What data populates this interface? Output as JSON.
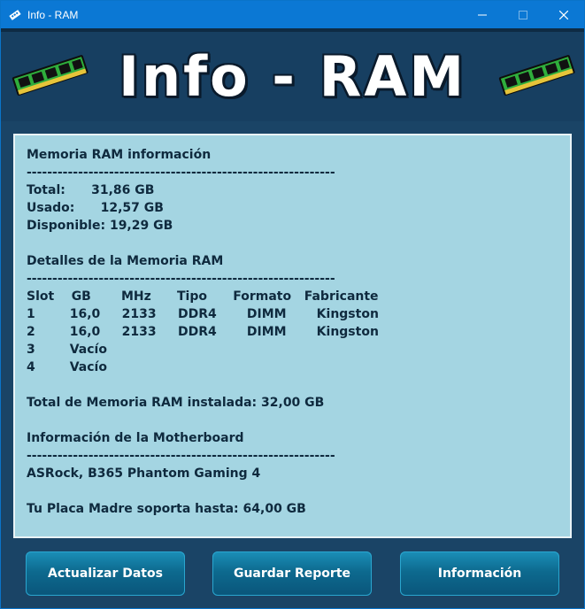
{
  "window": {
    "title": "Info - RAM",
    "controls": [
      "minimize",
      "maximize",
      "close"
    ]
  },
  "banner": {
    "title": "Info - RAM"
  },
  "report": {
    "lines": [
      "Memoria RAM información",
      "------------------------------------------------------------",
      "Total:      31,86 GB",
      "Usado:      12,57 GB",
      "Disponible: 19,29 GB",
      "",
      "Detalles de la Memoria RAM",
      "------------------------------------------------------------",
      "Slot    GB       MHz      Tipo      Formato   Fabricante",
      "1        16,0     2133     DDR4       DIMM       Kingston",
      "2        16,0     2133     DDR4       DIMM       Kingston",
      "3        Vacío",
      "4        Vacío",
      "",
      "Total de Memoria RAM instalada: 32,00 GB",
      "",
      "Información de la Motherboard",
      "------------------------------------------------------------",
      "ASRock, B365 Phantom Gaming 4",
      "",
      "Tu Placa Madre soporta hasta: 64,00 GB"
    ]
  },
  "buttons": {
    "refresh": "Actualizar Datos",
    "save": "Guardar Reporte",
    "info": "Información"
  },
  "icons": {
    "app": "ram-module-icon",
    "banner_left": "ram-module-icon",
    "banner_right": "ram-module-icon"
  },
  "colors": {
    "titlebar": "#0b78d4",
    "background": "#1a4466",
    "panel": "#a4d5e2",
    "button": "#0d6a8f"
  }
}
